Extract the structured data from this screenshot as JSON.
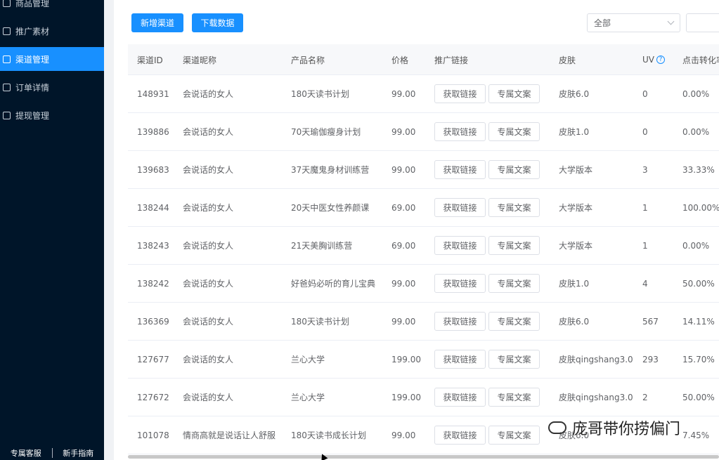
{
  "sidebar": {
    "items": [
      {
        "label": "商品管理",
        "icon": "box-icon",
        "active": false
      },
      {
        "label": "推广素材",
        "icon": "copy-icon",
        "active": false
      },
      {
        "label": "渠道管理",
        "icon": "grid-icon",
        "active": true
      },
      {
        "label": "订单详情",
        "icon": "bank-icon",
        "active": false
      },
      {
        "label": "提现管理",
        "icon": "wallet-icon",
        "active": false
      }
    ],
    "footer": {
      "support": "专属客服",
      "guide": "新手指南"
    }
  },
  "toolbar": {
    "add_channel": "新增渠道",
    "download_data": "下载数据",
    "filter_selected": "全部"
  },
  "table": {
    "columns": [
      "渠道ID",
      "渠道昵称",
      "产品名称",
      "价格",
      "推广链接",
      "皮肤",
      "UV",
      "点击转化率"
    ],
    "buttons": {
      "get_link": "获取链接",
      "copy_text": "专属文案"
    },
    "rows": [
      {
        "id": "148931",
        "nickname": "会说话的女人",
        "product": "180天读书计划",
        "price": "99.00",
        "skin": "皮肤6.0",
        "uv": "0",
        "rate": "0.00%"
      },
      {
        "id": "139886",
        "nickname": "会说话的女人",
        "product": "70天瑜伽瘦身计划",
        "price": "99.00",
        "skin": "皮肤1.0",
        "uv": "0",
        "rate": "0.00%"
      },
      {
        "id": "139683",
        "nickname": "会说话的女人",
        "product": "37天魔鬼身材训练营",
        "price": "99.00",
        "skin": "大学版本",
        "uv": "3",
        "rate": "33.33%"
      },
      {
        "id": "138244",
        "nickname": "会说话的女人",
        "product": "20天中医女性养颜课",
        "price": "69.00",
        "skin": "大学版本",
        "uv": "1",
        "rate": "100.00%"
      },
      {
        "id": "138243",
        "nickname": "会说话的女人",
        "product": "21天美胸训练营",
        "price": "69.00",
        "skin": "大学版本",
        "uv": "1",
        "rate": "0.00%"
      },
      {
        "id": "138242",
        "nickname": "会说话的女人",
        "product": "好爸妈必听的育儿宝典",
        "price": "99.00",
        "skin": "皮肤1.0",
        "uv": "4",
        "rate": "50.00%"
      },
      {
        "id": "136369",
        "nickname": "会说话的女人",
        "product": "180天读书计划",
        "price": "99.00",
        "skin": "皮肤6.0",
        "uv": "567",
        "rate": "14.11%"
      },
      {
        "id": "127677",
        "nickname": "会说话的女人",
        "product": "兰心大学",
        "price": "199.00",
        "skin": "皮肤qingshang3.0",
        "uv": "293",
        "rate": "15.70%"
      },
      {
        "id": "127672",
        "nickname": "会说话的女人",
        "product": "兰心大学",
        "price": "199.00",
        "skin": "皮肤qingshang3.0",
        "uv": "2",
        "rate": "50.00%"
      },
      {
        "id": "101078",
        "nickname": "情商高就是说话让人舒服",
        "product": "180天读书成长计划",
        "price": "99.00",
        "skin": "皮肤6.0",
        "uv": "",
        "rate": "7.45%"
      }
    ]
  },
  "watermark": "庞哥带你捞偏门",
  "colors": {
    "sidebar_bg": "#001529",
    "primary": "#1890ff",
    "active_nav": "#1890ff"
  }
}
